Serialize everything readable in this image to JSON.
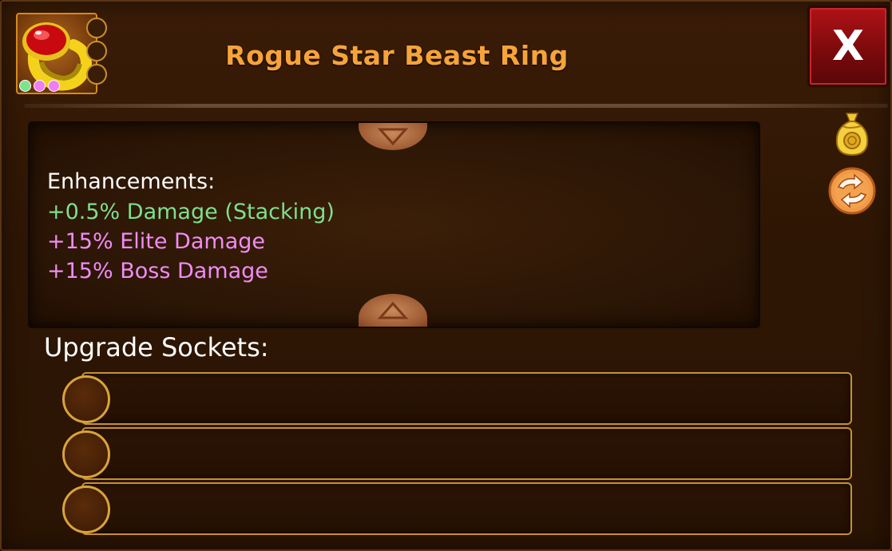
{
  "item": {
    "name": "Rogue Star Beast Ring",
    "icon": "ruby-ring-icon",
    "gem_colors": [
      "#7de38f",
      "#f07ef0",
      "#f07ef0"
    ],
    "socket_count": 3
  },
  "header": {
    "close_label": "X"
  },
  "enhancements": {
    "heading": "Enhancements:",
    "lines": [
      {
        "text": "+0.5% Damage (Stacking)",
        "color": "#7ee08c"
      },
      {
        "text": "+15% Elite Damage",
        "color": "#f08cf5"
      },
      {
        "text": "+15% Boss Damage",
        "color": "#f08cf5"
      }
    ]
  },
  "side_actions": {
    "sell_icon": "gold-coin-bag-icon",
    "swap_icon": "swap-arrows-icon"
  },
  "upgrade": {
    "label": "Upgrade Sockets:",
    "sockets": [
      "",
      "",
      ""
    ]
  },
  "colors": {
    "title": "#f6a33a",
    "gold_border": "#c8902e",
    "close_red": "#b01217"
  }
}
